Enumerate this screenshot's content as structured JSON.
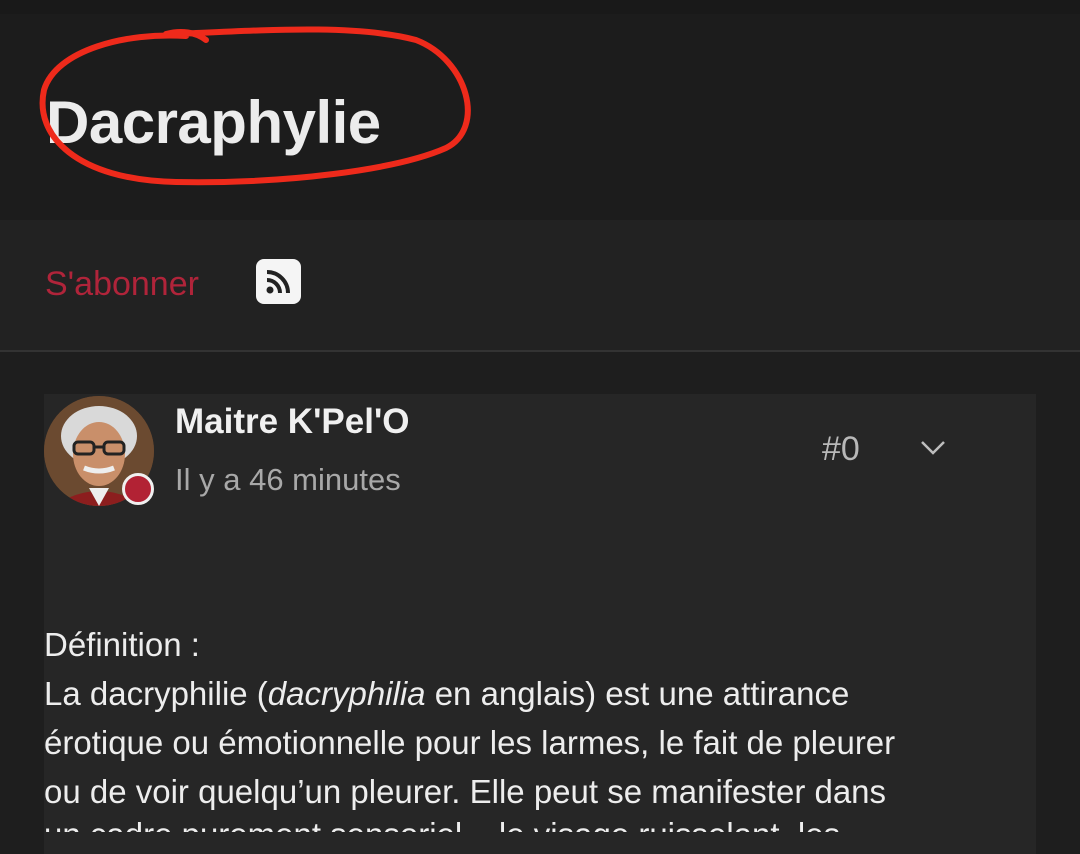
{
  "header": {
    "title": "Dacraphylie"
  },
  "actions": {
    "subscribe_label": "S'abonner",
    "rss_icon": "rss-icon"
  },
  "post": {
    "author": "Maitre K'Pel'O",
    "time": "Il y a 46 minutes",
    "number": "#0",
    "status_color": "#b22234",
    "body": {
      "heading": "Définition :",
      "line_prefix": "La dacryphilie (",
      "italic_term": "dacryphilia",
      "line_suffix": " en anglais) est une attirance",
      "line2": "érotique ou émotionnelle pour les larmes, le fait de pleurer",
      "line3": "ou de voir quelqu’un pleurer. Elle peut se manifester dans",
      "line4": "un cadre purement sensoriel – le visage ruisselant, les"
    }
  },
  "colors": {
    "accent": "#b0243a",
    "annotation": "#ee2a1b"
  }
}
